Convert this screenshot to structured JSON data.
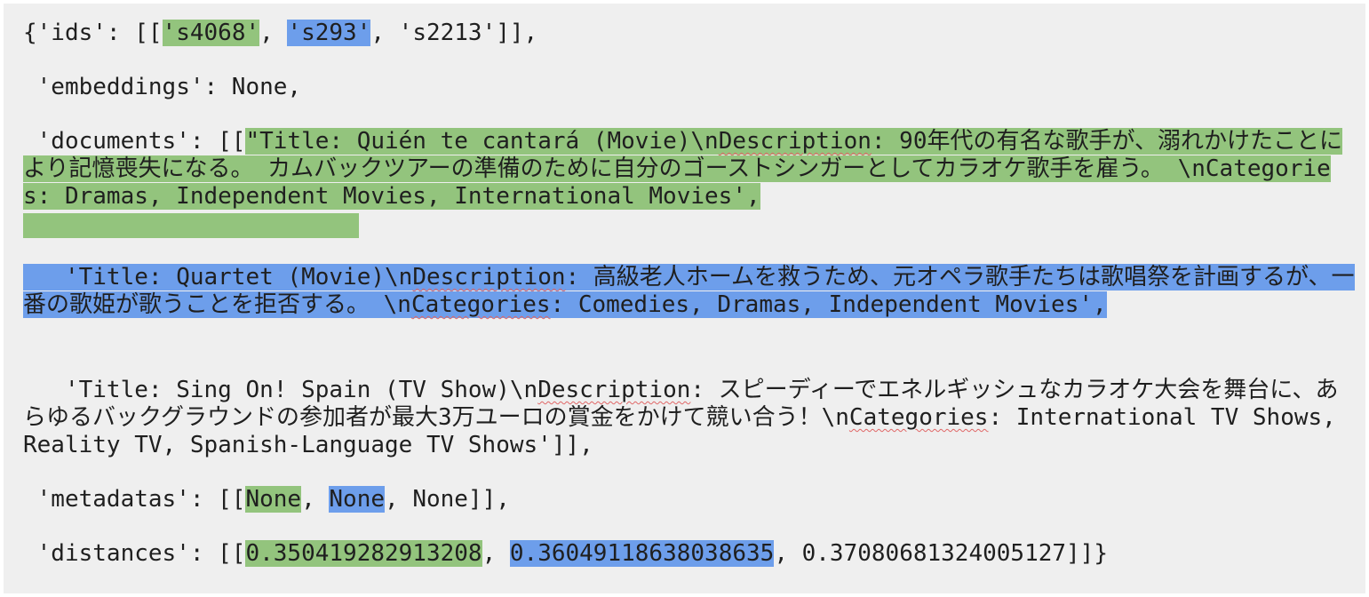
{
  "ids": {
    "prefix": "{'ids': [[",
    "id1": "'s4068'",
    "sep1": ", ",
    "id2": "'s293'",
    "rest": ", 's2213']],"
  },
  "embeddings": {
    "line": " 'embeddings': None,"
  },
  "documents": {
    "prefix": " 'documents': [[",
    "doc1": {
      "a": "\"Title: Quién te cantará (Movie)\\n",
      "b": "Description",
      "c": ": 90年代の有名な歌手が、溺れかけたことにより記憶喪失になる。 カムバックツアーの準備のために自分のゴーストシンガーとしてカラオケ歌手を雇う。 \\nCategories: Dramas, Independent Movies, International Movies',"
    },
    "doc2": {
      "indent": "   ",
      "a": "'Title: Quartet (Movie)\\n",
      "b": "Description",
      "c": ": 高級老人ホームを救うため、元オペラ歌手たちは歌唱祭を計画するが、一番の歌姫が歌うことを拒否する。 \\n",
      "d": "Categories",
      "e": ": Comedies, Dramas, Independent Movies',"
    },
    "doc3": {
      "indent": "   ",
      "a": "'Title: Sing On! Spain (TV Show)\\n",
      "b": "Description",
      "c": ": スピーディーでエネルギッシュなカラオケ大会を舞台に、あらゆるバックグラウンドの参加者が最大3万ユーロの賞金をかけて競い合う！\\n",
      "d": "Categories",
      "e": ": International TV Shows, Reality TV, Spanish-Language TV Shows']],"
    }
  },
  "metadatas": {
    "prefix": " 'metadatas': [[",
    "m1": "None",
    "sep1": ", ",
    "m2": "None",
    "rest": ", None]],"
  },
  "distances": {
    "prefix": " 'distances': [[",
    "d1": "0.350419282913208",
    "sep1": ", ",
    "d2": "0.36049118638038635",
    "rest": ", 0.37080681324005127]]}"
  },
  "colors": {
    "panel_bg": "#efefef",
    "highlight_green": "#93c47d",
    "highlight_blue": "#6d9eeb",
    "text": "#1f1f1f",
    "spellcheck_underline": "#e06666"
  }
}
